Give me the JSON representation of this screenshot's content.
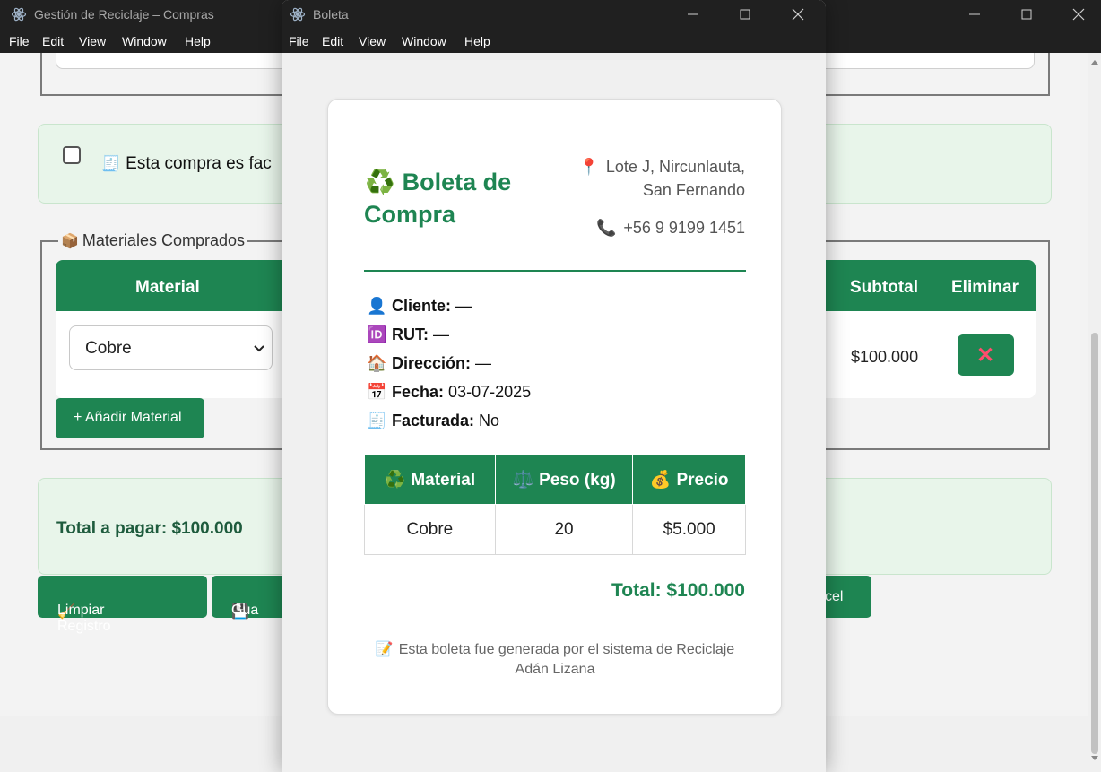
{
  "main_window": {
    "title": "Gestión de Reciclaje – Compras",
    "menu": [
      "File",
      "Edit",
      "View",
      "Window",
      "Help"
    ],
    "factura_label": "Esta compra es fac",
    "factura_icon": "receipt-icon",
    "materials_legend": "Materiales Comprados",
    "materials_icon": "package-icon",
    "table_headers": {
      "material": "Material",
      "subtotal": "Subtotal",
      "eliminar": "Eliminar"
    },
    "row": {
      "material": "Cobre",
      "subtotal": "$100.000",
      "delete": "✕"
    },
    "add_material": "+ Añadir Material",
    "total_label": "Total a pagar:",
    "total_value": "$100.000",
    "buttons": {
      "limpiar": "Limpiar Registro",
      "guardar": "Gua",
      "excel": "xcel"
    },
    "accent_color": "#1e8552"
  },
  "modal": {
    "title": "Boleta",
    "menu": [
      "File",
      "Edit",
      "View",
      "Window",
      "Help"
    ],
    "boleta_title_line1": "Boleta de",
    "boleta_title_line2": "Compra",
    "address_line1": "Lote J, Nircunlauta,",
    "address_line2": "San Fernando",
    "phone": "+56 9 9199 1451",
    "info": [
      {
        "label": "Cliente:",
        "value": "—",
        "icon": "person-icon"
      },
      {
        "label": "RUT:",
        "value": "—",
        "icon": "id-icon"
      },
      {
        "label": "Dirección:",
        "value": "—",
        "icon": "house-icon"
      },
      {
        "label": "Fecha:",
        "value": "03-07-2025",
        "icon": "calendar-icon"
      },
      {
        "label": "Facturada:",
        "value": "No",
        "icon": "receipt-icon"
      }
    ],
    "table_headers": {
      "material": "Material",
      "peso": "Peso (kg)",
      "precio": "Precio"
    },
    "table_row": {
      "material": "Cobre",
      "peso": "20",
      "precio": "$5.000"
    },
    "total": "Total: $100.000",
    "footer_line1": "Esta boleta fue generada por el sistema de Reciclaje",
    "footer_line2": "Adán Lizana"
  }
}
